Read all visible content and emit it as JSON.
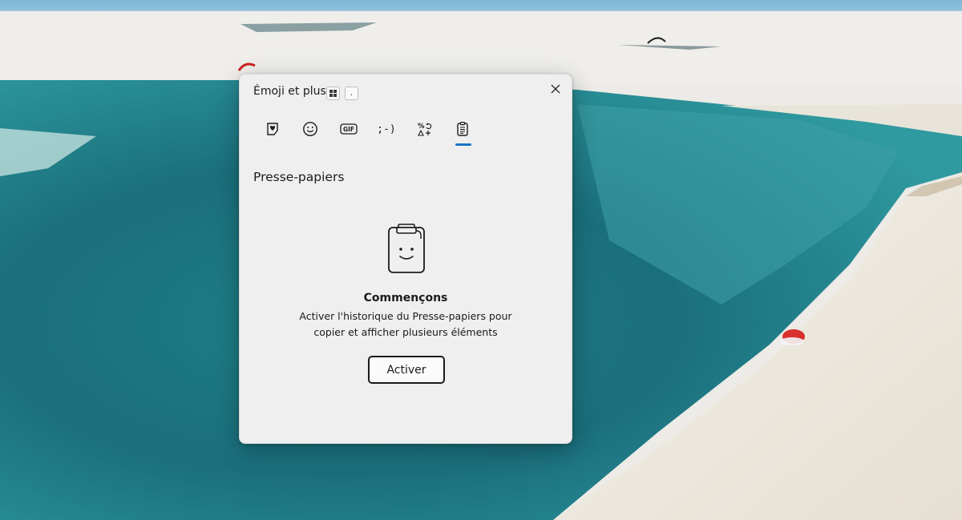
{
  "window": {
    "title": "Émoji et plus",
    "shortcut_dot": "."
  },
  "tabs": [
    {
      "name": "tab-recent",
      "icon": "heart-sticker-icon"
    },
    {
      "name": "tab-emoji",
      "icon": "smiley-icon"
    },
    {
      "name": "tab-gif",
      "label": "GIF"
    },
    {
      "name": "tab-kaomoji",
      "label": ";-)"
    },
    {
      "name": "tab-symbols",
      "icon": "symbols-icon"
    },
    {
      "name": "tab-clipboard",
      "icon": "clipboard-icon",
      "selected": true
    }
  ],
  "clipboard": {
    "section_title": "Presse-papiers",
    "heading": "Commençons",
    "description_line1": "Activer l'historique du Presse-papiers pour",
    "description_line2": "copier et afficher plusieurs éléments",
    "activate_label": "Activer"
  },
  "colors": {
    "accent": "#1a73c8",
    "panel_bg": "#efefef"
  }
}
